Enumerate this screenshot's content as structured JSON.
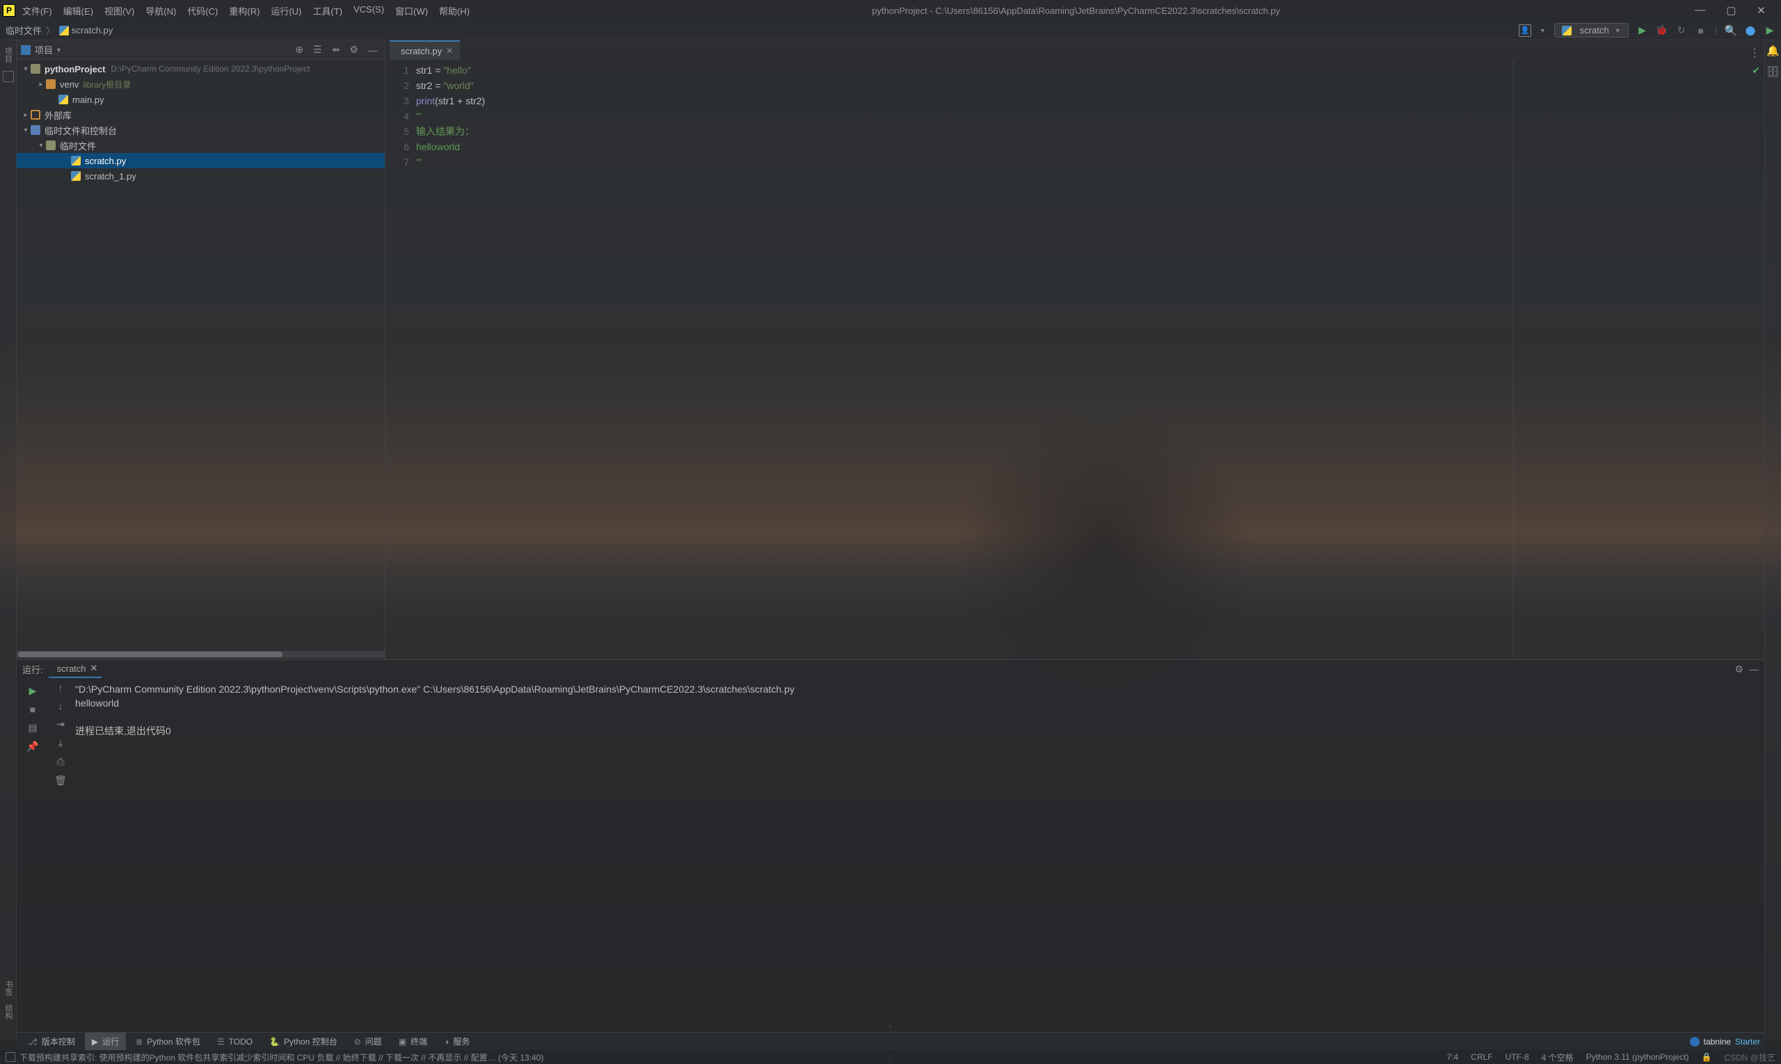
{
  "menu": {
    "file": "文件(F)",
    "edit": "编辑(E)",
    "view": "视图(V)",
    "navigate": "导航(N)",
    "code": "代码(C)",
    "refactor": "重构(R)",
    "run": "运行(U)",
    "tools": "工具(T)",
    "vcs": "VCS(S)",
    "window": "窗口(W)",
    "help": "帮助(H)"
  },
  "window_title": "pythonProject - C:\\Users\\86156\\AppData\\Roaming\\JetBrains\\PyCharmCE2022.3\\scratches\\scratch.py",
  "breadcrumbs": {
    "root": "临时文件",
    "file": "scratch.py"
  },
  "run_config": "scratch",
  "project_header": {
    "label": "项目"
  },
  "tree": {
    "project_name": "pythonProject",
    "project_path": "D:\\PyCharm Community Edition 2022.3\\pythonProject",
    "venv": "venv",
    "venv_badge": "library根目录",
    "main_py": "main.py",
    "ext_libs": "外部库",
    "scratches_root": "临时文件和控制台",
    "scratches_folder": "临时文件",
    "scratch_py": "scratch.py",
    "scratch1_py": "scratch_1.py"
  },
  "editor": {
    "tab": "scratch.py",
    "lines": {
      "l1_id1": "str1",
      "l1_op": " = ",
      "l1_str": "\"hello\"",
      "l2_id1": "str2",
      "l2_op": " = ",
      "l2_str": "\"world\"",
      "l3_fn": "print",
      "l3_rest": "(str1 + str2)",
      "l4": "'''",
      "l5": "输入结果为：",
      "l6": "helloworld",
      "l7": "'''"
    },
    "line_numbers": [
      "1",
      "2",
      "3",
      "4",
      "5",
      "6",
      "7"
    ]
  },
  "run_panel": {
    "title": "运行:",
    "tab": "scratch",
    "cmd": "\"D:\\PyCharm Community Edition 2022.3\\pythonProject\\venv\\Scripts\\python.exe\" C:\\Users\\86156\\AppData\\Roaming\\JetBrains\\PyCharmCE2022.3\\scratches\\scratch.py",
    "output": "helloworld",
    "exit": "进程已结束,退出代码0"
  },
  "bottom_tabs": {
    "vcs": "版本控制",
    "run": "运行",
    "pkg": "Python 软件包",
    "todo": "TODO",
    "pyconsole": "Python 控制台",
    "problems": "问题",
    "terminal": "终端",
    "services": "服务"
  },
  "left_vtabs": {
    "bookmarks": "书签",
    "structure": "结构"
  },
  "statusbar": {
    "indexing": "下载预构建共享索引: 使用预构建的Python 软件包共享索引减少索引时间和 CPU 负载 // 始终下载 // 下载一次 // 不再显示 // 配置… (今天 13:40)",
    "pos": "7:4",
    "eol": "CRLF",
    "encoding": "UTF-8",
    "indent": "4 个空格",
    "interpreter": "Python 3.11 (pythonProject)",
    "watermark": "CSDN @技艺"
  },
  "tabnine": {
    "brand": "tabnine",
    "tier": "Starter"
  }
}
